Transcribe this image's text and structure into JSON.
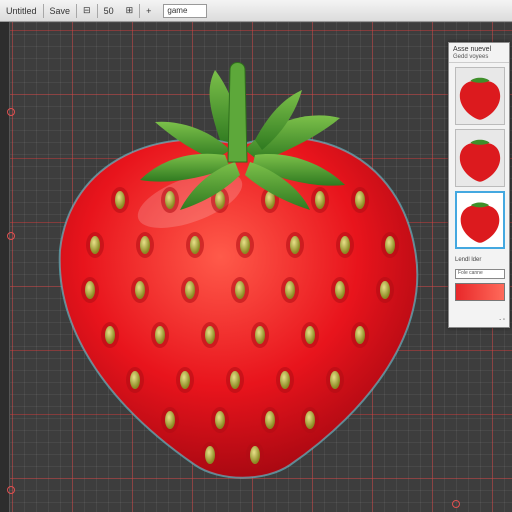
{
  "toolbar": {
    "items": [
      {
        "label": "Untitled"
      },
      {
        "label": "Save"
      },
      {
        "label": "⊟"
      },
      {
        "label": "50"
      },
      {
        "label": "⊞"
      },
      {
        "label": "+"
      }
    ],
    "zoom_value": "game"
  },
  "panel": {
    "title": "Asse nuevel",
    "subtitle": "Gedd voyees",
    "label_size": "Lendl lder",
    "color_field": "Fole canne",
    "footer": "- ▫"
  },
  "colors": {
    "accent": "#44a8e0",
    "guide": "#e05050",
    "swatch": "#e8282a"
  }
}
